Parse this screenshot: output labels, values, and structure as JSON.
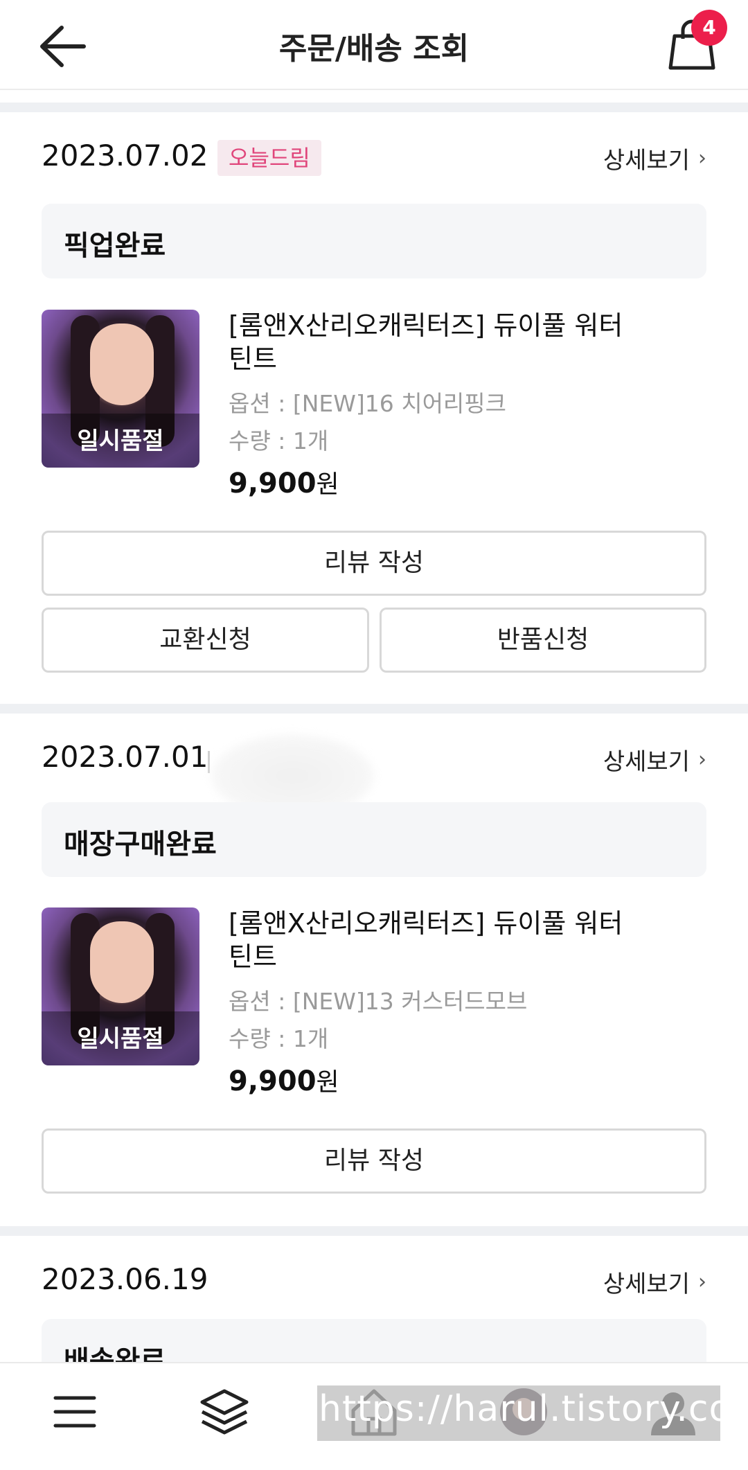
{
  "header": {
    "title": "주문/배송 조회",
    "cart_count": "4"
  },
  "orders": [
    {
      "date": "2023.07.02",
      "store_tag": "오늘드림",
      "detail_label": "상세보기",
      "status": "픽업완료",
      "product": {
        "thumb_label": "일시품절",
        "name": "[롬앤X산리오캐릭터즈] 듀이풀 워터 틴트",
        "option": "옵션 : [NEW]16 치어리핑크",
        "quantity": "수량 : 1개",
        "price_num": "9,900",
        "price_unit": "원"
      },
      "buttons": {
        "review": "리뷰 작성",
        "exchange": "교환신청",
        "return": "반품신청"
      }
    },
    {
      "date": "2023.07.01",
      "detail_label": "상세보기",
      "status": "매장구매완료",
      "product": {
        "thumb_label": "일시품절",
        "name": "[롬앤X산리오캐릭터즈] 듀이풀 워터 틴트",
        "option": "옵션 : [NEW]13 커스터드모브",
        "quantity": "수량 : 1개",
        "price_num": "9,900",
        "price_unit": "원"
      },
      "buttons": {
        "review": "리뷰 작성"
      }
    },
    {
      "date": "2023.06.19",
      "detail_label": "상세보기",
      "status": "배송완료"
    }
  ],
  "bottom_nav": {
    "items": [
      "menu-icon",
      "layers-icon",
      "home-icon",
      "recent-product-icon",
      "mypage-icon"
    ]
  },
  "watermark": "https://harul.tistory.com",
  "colors": {
    "accent": "#ec1f4b",
    "tag_text": "#e0457b",
    "tag_bg": "#f6e9ee",
    "separator": "#eef0f3"
  }
}
